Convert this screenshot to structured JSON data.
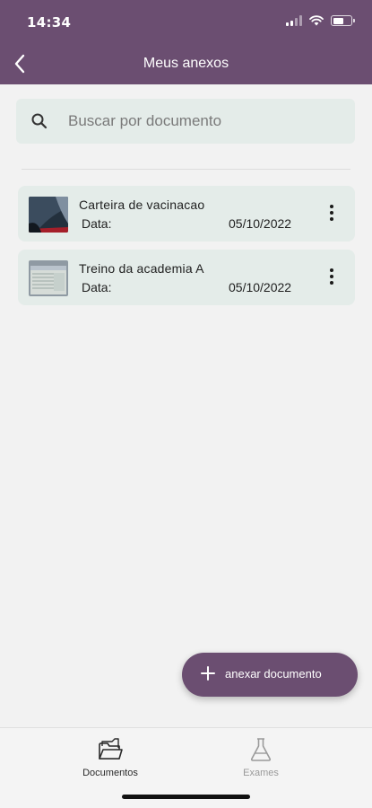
{
  "status_bar": {
    "time": "14:34"
  },
  "header": {
    "title": "Meus anexos",
    "back_icon": "chevron-left-icon"
  },
  "search": {
    "placeholder": "Buscar por documento",
    "value": ""
  },
  "documents": [
    {
      "name": "Carteira de vacinacao",
      "date_label": "Data:",
      "date": "05/10/2022",
      "thumbnail": "dark-document-photo"
    },
    {
      "name": "Treino da academia A",
      "date_label": "Data:",
      "date": "05/10/2022",
      "thumbnail": "light-paper-photo"
    }
  ],
  "fab": {
    "label": "anexar documento",
    "icon": "plus-icon"
  },
  "bottom_nav": {
    "items": [
      {
        "label": "Documentos",
        "icon": "folder-icon",
        "active": true
      },
      {
        "label": "Exames",
        "icon": "flask-icon",
        "active": false
      }
    ]
  },
  "colors": {
    "primary": "#6b4e71",
    "card": "#e4ece9",
    "background": "#f2f2f2",
    "active_nav": "#2a2a2a",
    "inactive_nav": "#9a9a9a"
  }
}
